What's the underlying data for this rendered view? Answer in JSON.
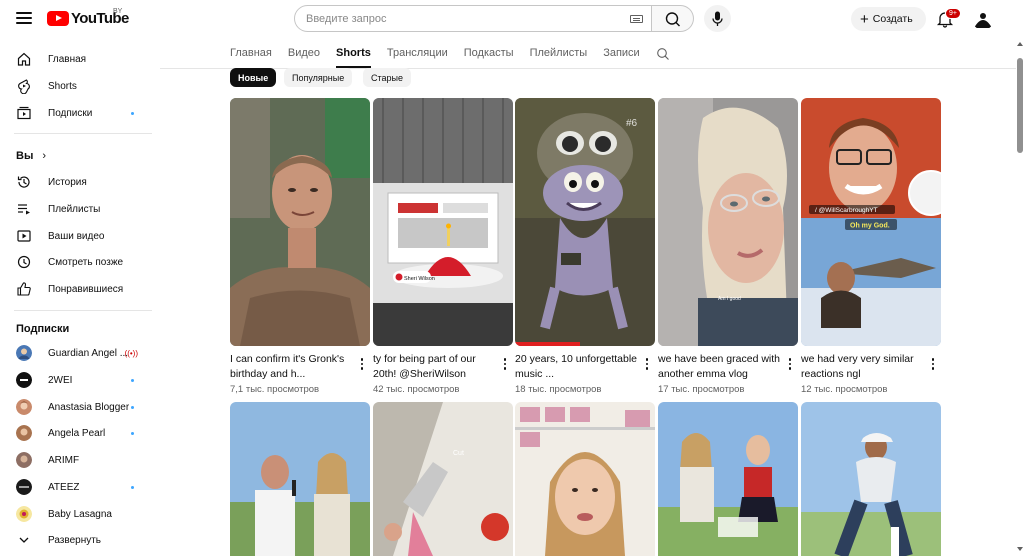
{
  "header": {
    "logo_text": "YouTube",
    "country_code": "BY",
    "search_placeholder": "Введите запрос",
    "create_label": "Создать",
    "notification_count": "9+"
  },
  "sidebar": {
    "main": [
      {
        "label": "Главная",
        "icon": "home-icon"
      },
      {
        "label": "Shorts",
        "icon": "shorts-icon"
      },
      {
        "label": "Подписки",
        "icon": "subscriptions-icon",
        "dot": true
      }
    ],
    "you_heading": "Вы",
    "you": [
      {
        "label": "История",
        "icon": "history-icon"
      },
      {
        "label": "Плейлисты",
        "icon": "playlists-icon"
      },
      {
        "label": "Ваши видео",
        "icon": "your-videos-icon"
      },
      {
        "label": "Смотреть позже",
        "icon": "watch-later-icon"
      },
      {
        "label": "Понравившиеся",
        "icon": "like-icon"
      }
    ],
    "subs_heading": "Подписки",
    "subscriptions": [
      {
        "label": "Guardian Angel ...",
        "color": "#4a78b5",
        "live": true
      },
      {
        "label": "2WEI",
        "color": "#111111",
        "dot": true
      },
      {
        "label": "Anastasia Blogger",
        "color": "#c98a6b",
        "dot": true
      },
      {
        "label": "Angela Pearl",
        "color": "#a8734f",
        "dot": true
      },
      {
        "label": "ARIMF",
        "color": "#8d6e63"
      },
      {
        "label": "ATEEZ",
        "color": "#1a1a1a",
        "dot": true
      },
      {
        "label": "Baby Lasagna",
        "color": "#e0b030"
      }
    ],
    "expand_label": "Развернуть"
  },
  "tabs": [
    "Главная",
    "Видео",
    "Shorts",
    "Трансляции",
    "Подкасты",
    "Плейлисты",
    "Записи"
  ],
  "active_tab": "Shorts",
  "chips": [
    "Новые",
    "Популярные",
    "Старые"
  ],
  "active_chip": "Новые",
  "shorts_row1": [
    {
      "title": "I can confirm it's Gronk's birthday and h...",
      "views": "7,1 тыс. просмотров"
    },
    {
      "title": "ty for being part of our 20th! @SheriWilson",
      "views": "42 тыс. просмотров"
    },
    {
      "title": "20 years, 10 unforgettable music ...",
      "views": "18 тыс. просмотров"
    },
    {
      "title": "we have been graced with another emma vlog",
      "views": "17 тыс. просмотров"
    },
    {
      "title": "we had very very similar reactions ngl",
      "views": "12 тыс. просмотров"
    }
  ],
  "thumb_overlays": {
    "sheri_tag": "Sheri Wilson",
    "frog_number": "#6",
    "emma_caption": "Am I good",
    "handle": "/ @WillScarbroughYT",
    "ohmygod": "Oh my God.",
    "cut": "Cut"
  }
}
